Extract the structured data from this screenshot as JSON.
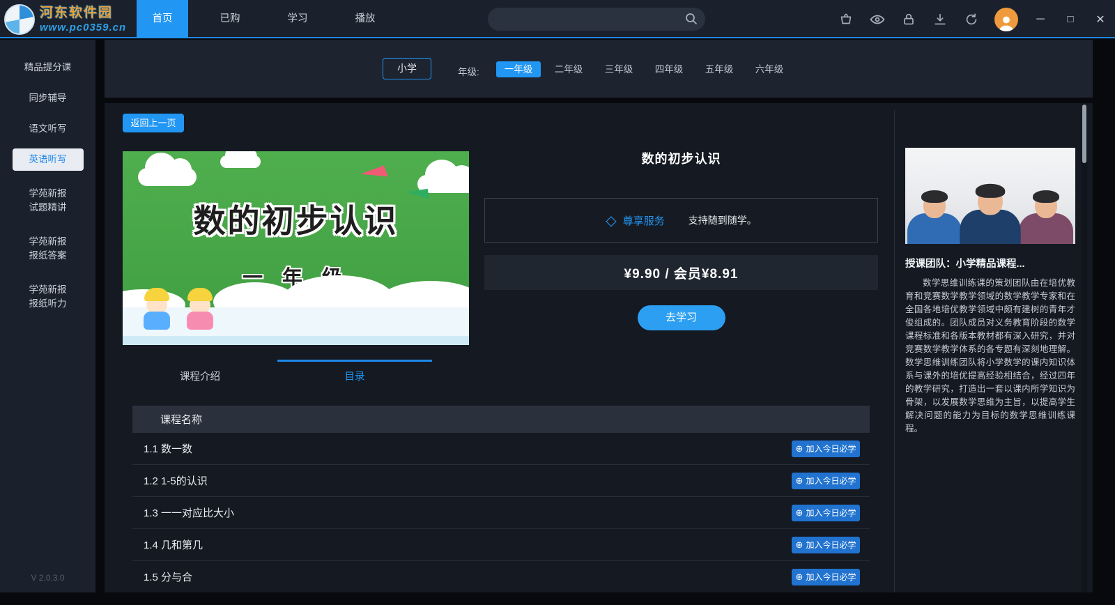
{
  "watermark": {
    "name": "河东软件园",
    "url": "www.pc0359.cn"
  },
  "header": {
    "tabs": [
      {
        "label": "首页",
        "active": true
      },
      {
        "label": "已购",
        "active": false
      },
      {
        "label": "学习",
        "active": false
      },
      {
        "label": "播放",
        "active": false
      }
    ],
    "window_controls": {
      "minimize": "─",
      "maximize": "□",
      "close": "✕"
    }
  },
  "sidebar": {
    "items": [
      {
        "label": "精品提分课",
        "active": false
      },
      {
        "label": "同步辅导",
        "active": false
      },
      {
        "label": "语文听写",
        "active": false
      },
      {
        "label": "英语听写",
        "active": true
      },
      {
        "label": "学苑新报\n试题精讲",
        "active": false
      },
      {
        "label": "学苑新报\n报纸答案",
        "active": false
      },
      {
        "label": "学苑新报\n报纸听力",
        "active": false
      }
    ],
    "version": "V 2.0.3.0"
  },
  "filters": {
    "level": "小学",
    "grade_label": "年级:",
    "grades": [
      {
        "label": "一年级",
        "active": true
      },
      {
        "label": "二年级",
        "active": false
      },
      {
        "label": "三年级",
        "active": false
      },
      {
        "label": "四年级",
        "active": false
      },
      {
        "label": "五年级",
        "active": false
      },
      {
        "label": "六年级",
        "active": false
      }
    ]
  },
  "course": {
    "back_label": "返回上一页",
    "title": "数的初步认识",
    "cover": {
      "title": "数的初步认识",
      "grade": "一 年 级"
    },
    "service": {
      "icon": "◇",
      "label": "尊享服务",
      "note": "支持随到随学。"
    },
    "price": "¥9.90 / 会员¥8.91",
    "study_label": "去学习",
    "tabs": [
      {
        "label": "课程介绍",
        "active": false
      },
      {
        "label": "目录",
        "active": true
      }
    ],
    "list_header": "课程名称",
    "add_icon": "⊕",
    "add_label": "加入今日必学",
    "lessons": [
      {
        "name": "1.1 数一数"
      },
      {
        "name": "1.2 1-5的认识"
      },
      {
        "name": "1.3 一一对应比大小"
      },
      {
        "name": "1.4 几和第几"
      },
      {
        "name": "1.5 分与合"
      }
    ]
  },
  "team": {
    "title": "授课团队：小学精品课程...",
    "description": "数学思维训练课的策划团队由在培优教育和竞赛数学教学领域的数学教学专家和在全国各地培优教学领域中颇有建树的青年才俊组成的。团队成员对义务教育阶段的数学课程标准和各版本教材都有深入研究，并对竞赛数学教学体系的各专题有深刻地理解。数学思维训练团队将小学数学的课内知识体系与课外的培优提高经验相结合，经过四年的教学研究，打造出一套以课内所学知识为骨架，以发展数学思维为主旨，以提高学生解决问题的能力为目标的数学思维训练课程。"
  },
  "colors": {
    "accent": "#2196f3"
  }
}
